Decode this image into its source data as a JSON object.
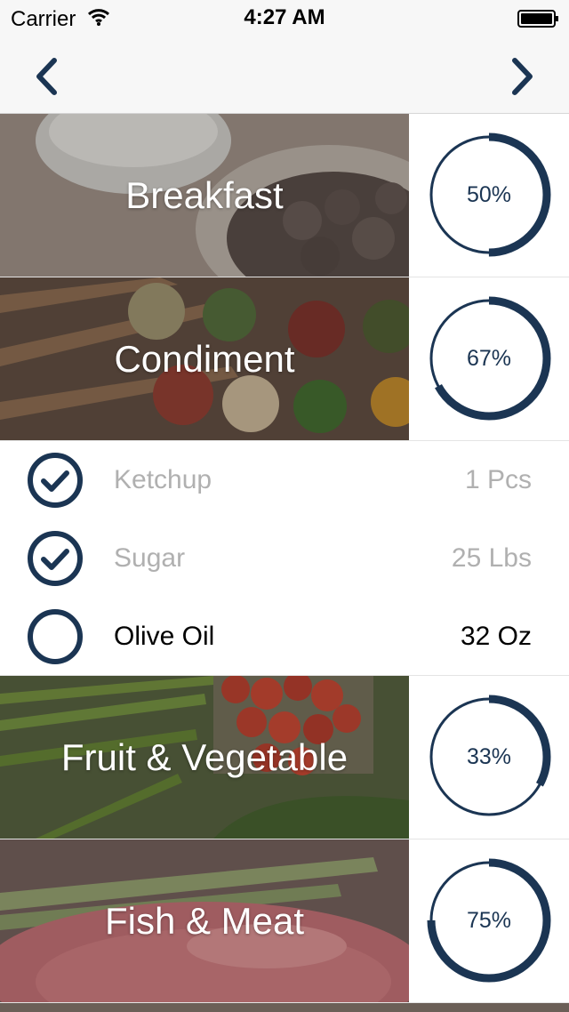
{
  "status_bar": {
    "carrier": "Carrier",
    "time": "4:27 AM"
  },
  "nav": {
    "back_icon": "chevron-left-icon",
    "forward_icon": "chevron-right-icon"
  },
  "colors": {
    "accent": "#1b3553",
    "ring_track": "#ffffff",
    "done_text": "#b0b0b0"
  },
  "categories": [
    {
      "title": "Breakfast",
      "progress": 0.5,
      "progress_label": "50%"
    },
    {
      "title": "Condiment",
      "progress": 0.67,
      "progress_label": "67%"
    },
    {
      "title": "Fruit & Vegetable",
      "progress": 0.33,
      "progress_label": "33%"
    },
    {
      "title": "Fish & Meat",
      "progress": 0.75,
      "progress_label": "75%"
    }
  ],
  "condiment_items": [
    {
      "name": "Ketchup",
      "quantity": "1 Pcs",
      "checked": true
    },
    {
      "name": "Sugar",
      "quantity": "25 Lbs",
      "checked": true
    },
    {
      "name": "Olive Oil",
      "quantity": "32 Oz",
      "checked": false
    }
  ]
}
